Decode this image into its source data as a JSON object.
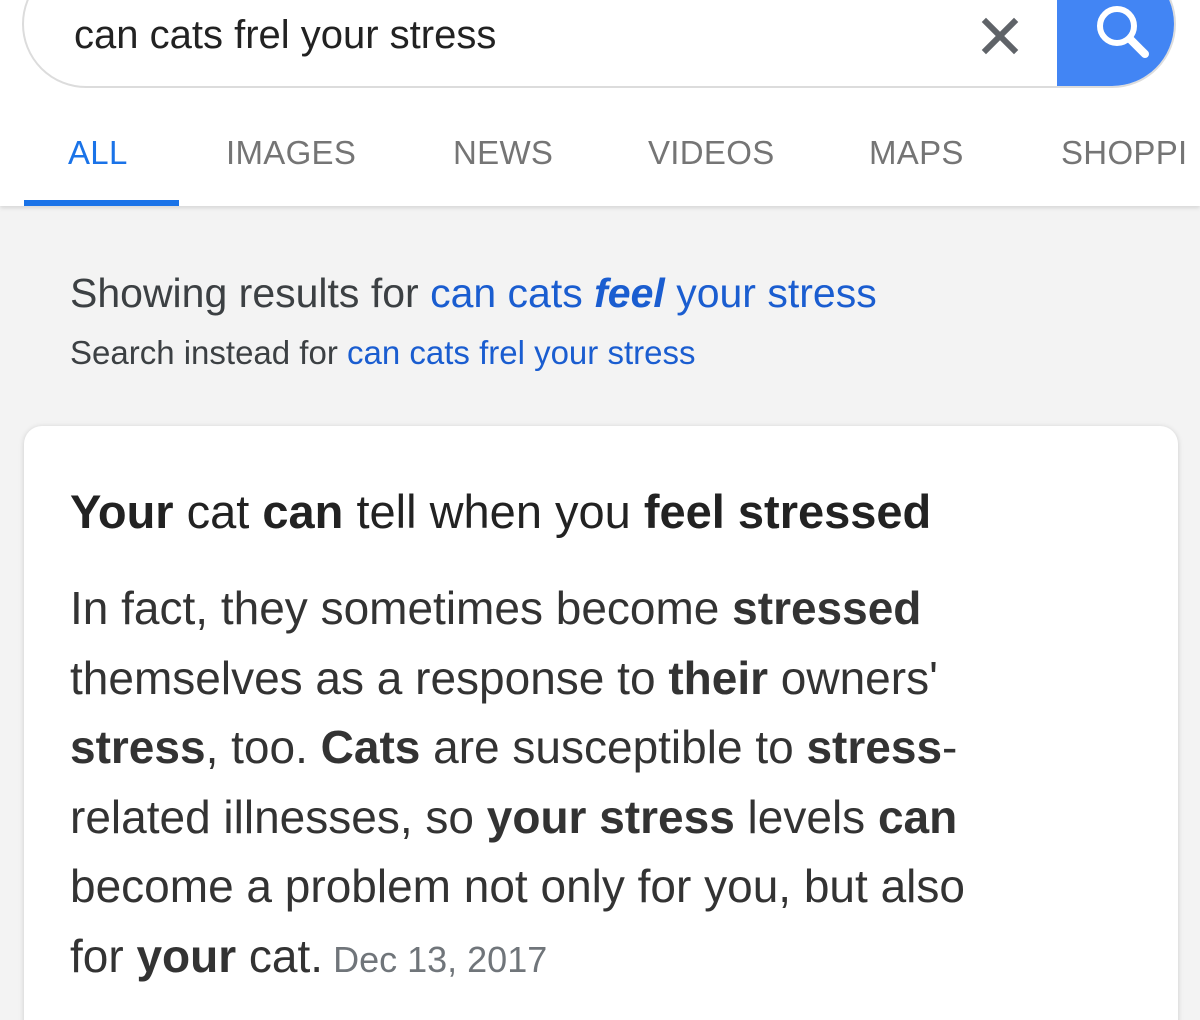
{
  "search": {
    "query": "can cats frel your stress"
  },
  "tabs": [
    {
      "label": "ALL",
      "active": true
    },
    {
      "label": "IMAGES",
      "active": false
    },
    {
      "label": "NEWS",
      "active": false
    },
    {
      "label": "VIDEOS",
      "active": false
    },
    {
      "label": "MAPS",
      "active": false
    },
    {
      "label": "SHOPPI",
      "active": false
    }
  ],
  "spelling": {
    "showing_prefix": "Showing results for ",
    "corrected_part1": "can cats ",
    "corrected_bold": "feel",
    "corrected_part2": " your stress",
    "instead_prefix": "Search instead for ",
    "original_query": "can cats frel your stress"
  },
  "answer": {
    "title": [
      {
        "text": "Your",
        "bold": true
      },
      {
        "text": " cat ",
        "bold": false
      },
      {
        "text": "can",
        "bold": true
      },
      {
        "text": " tell when you ",
        "bold": false
      },
      {
        "text": "feel stressed",
        "bold": true
      }
    ],
    "lines": [
      [
        {
          "text": "In fact, they sometimes become ",
          "bold": false
        },
        {
          "text": "stressed",
          "bold": true
        }
      ],
      [
        {
          "text": "themselves as a response to ",
          "bold": false
        },
        {
          "text": "their",
          "bold": true
        },
        {
          "text": " owners'",
          "bold": false
        }
      ],
      [
        {
          "text": "stress",
          "bold": true
        },
        {
          "text": ", too. ",
          "bold": false
        },
        {
          "text": "Cats",
          "bold": true
        },
        {
          "text": " are susceptible to ",
          "bold": false
        },
        {
          "text": "stress",
          "bold": true
        },
        {
          "text": "-",
          "bold": false
        }
      ],
      [
        {
          "text": "related illnesses, so ",
          "bold": false
        },
        {
          "text": "your stress",
          "bold": true
        },
        {
          "text": " levels ",
          "bold": false
        },
        {
          "text": "can",
          "bold": true
        }
      ],
      [
        {
          "text": "become a problem not only for you, but also",
          "bold": false
        }
      ],
      [
        {
          "text": "for ",
          "bold": false
        },
        {
          "text": "your",
          "bold": true
        },
        {
          "text": " cat.",
          "bold": false
        }
      ]
    ],
    "date": "Dec 13, 2017"
  },
  "colors": {
    "accent_blue": "#1a73e8",
    "link_blue": "#1a5dd0",
    "search_button": "#4285f4"
  },
  "icons": {
    "clear": "close-icon",
    "search": "search-icon"
  }
}
